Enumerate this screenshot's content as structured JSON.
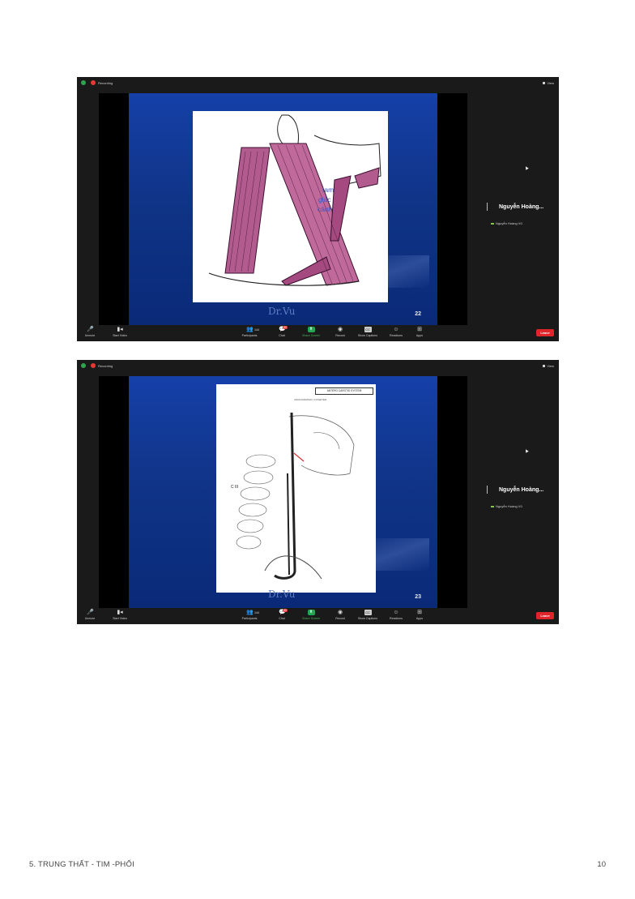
{
  "page": {
    "footer_title": "5. TRUNG THẤT - TIM -PHỔI",
    "page_number": "10"
  },
  "zoom": {
    "recording_label": "Recording",
    "view_label": "View",
    "participant_name": "Nguyễn Hoàng...",
    "participant_sub": "Nguyễn Hoàng Vũ",
    "toolbar": {
      "unmute": "Unmute",
      "start_video": "Start Video",
      "participants": "Participants",
      "participants_count": "144",
      "chat": "Chat",
      "chat_badge": "32",
      "share_screen": "Share Screen",
      "record": "Record",
      "show_captions": "Show Captions",
      "reactions": "Reactions",
      "apps": "Apps",
      "leave": "Leave"
    },
    "colors": {
      "share_green": "#22a652",
      "leave_red": "#e0252a",
      "slide_blue": "#1540a8"
    }
  },
  "slides": [
    {
      "number": "22",
      "watermark": "Dr.Vu",
      "label_lines": [
        "tam",
        "giác",
        "cảnh"
      ]
    },
    {
      "number": "23",
      "watermark": "Dr.Vu",
      "banner": "ANTERO CAROTID SYSTEM",
      "subtitle": "ANGIOGRAPHIC CATHETER",
      "vertebra_label": "C III"
    }
  ]
}
